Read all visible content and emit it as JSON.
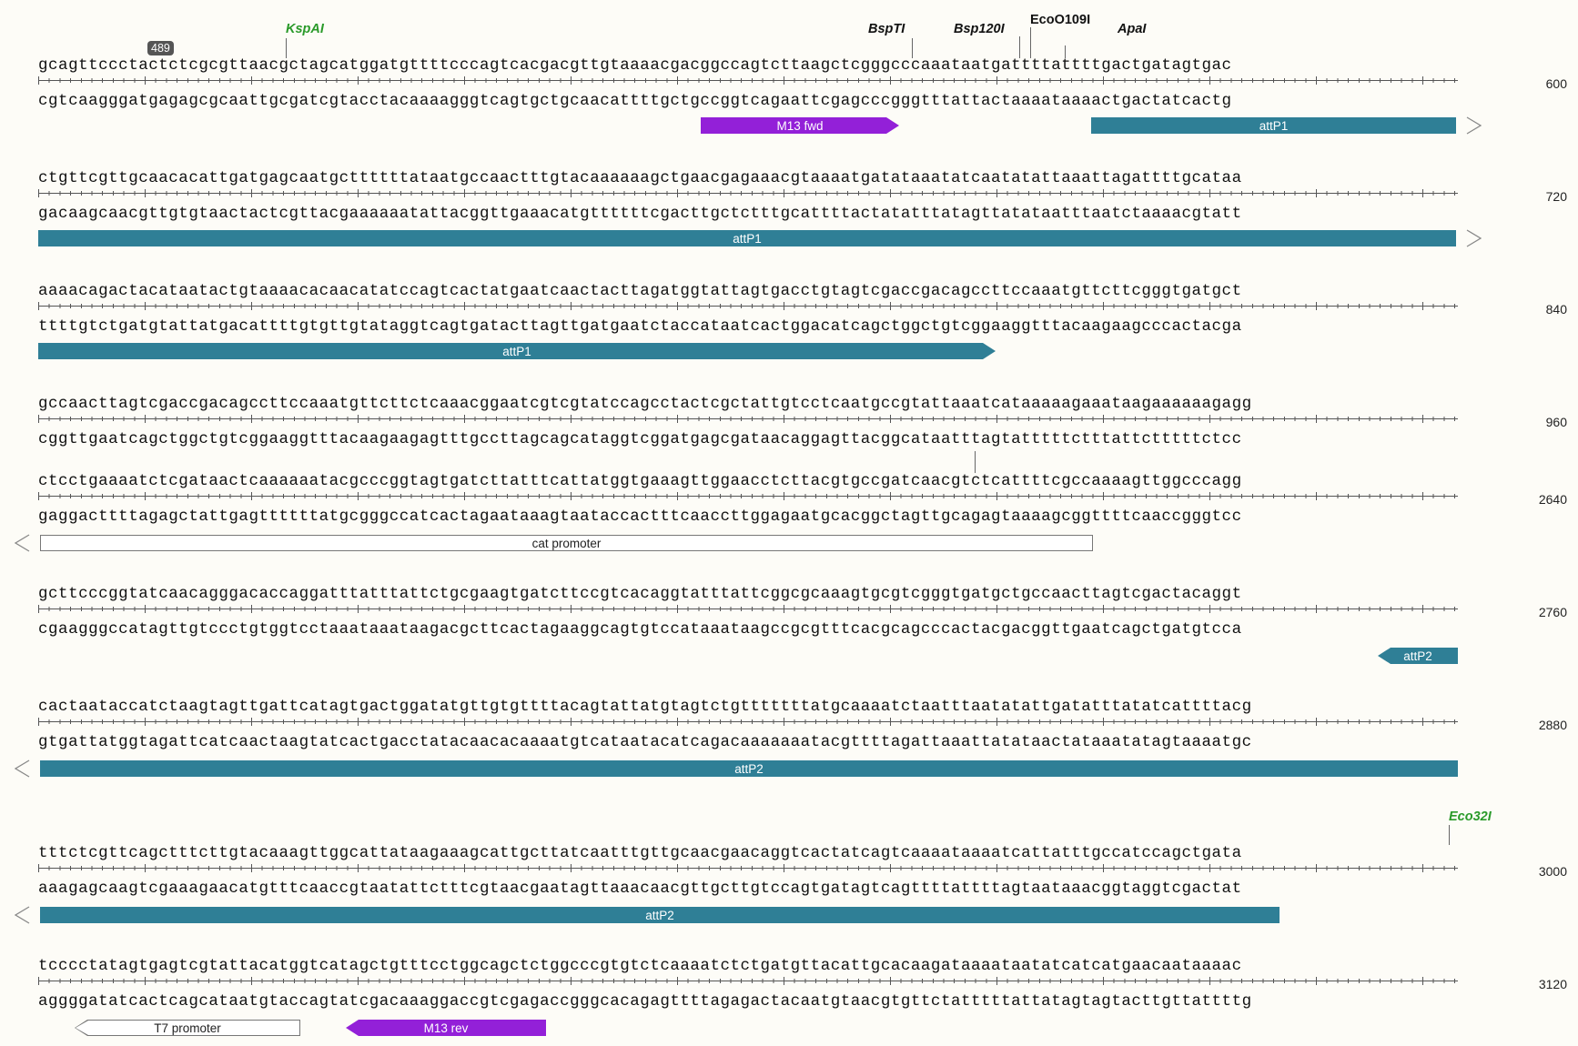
{
  "colors": {
    "background": "#fdfcf7",
    "feature_teal": "#2f7f96",
    "feature_purple": "#9320d8",
    "feature_white": "#ffffff",
    "enzyme_green": "#2a9a2a"
  },
  "badge": "489",
  "sites": {
    "kspai": "KspAI",
    "bspti": "BspTI",
    "bsp120i": "Bsp120I",
    "eco0109i": "EcoO109I",
    "apai": "ApaI",
    "eco32i": "Eco32I"
  },
  "rows": [
    {
      "top": "gcagttccctactctcgcgttaacgctagcatggatgttttcccagtcacgacgttgtaaaacgacggccagtcttaagctcgggcccaaataatgattttattttgactgatagtgac",
      "bottom": "cgtcaagggatgagagcgcaattgcgatcgtacctacaaaagggtcagtgctgcaacattttgctgccggtcagaattcgagcccgggtttattactaaaataaaactgactatcactg",
      "pos": "600",
      "features": [
        {
          "label": "M13 fwd"
        },
        {
          "label": "attP1"
        }
      ]
    },
    {
      "top": "ctgttcgttgcaacacattgatgagcaatgcttttttataatgccaactttgtacaaaaaagctgaacgagaaacgtaaaatgatataaatatcaatatattaaattagattttgcataa",
      "bottom": "gacaagcaacgttgtgtaactactcgttacgaaaaaatattacggttgaaacatgttttttcgacttgctctttgcattttactatatttatagttatataatttaatctaaaacgtatt",
      "pos": "720",
      "features": [
        {
          "label": "attP1"
        }
      ]
    },
    {
      "top": "aaaacagactacataatactgtaaaacacaacatatccagtcactatgaatcaactacttagatggtattagtgacctgtagtcgaccgacagccttccaaatgttcttcgggtgatgct",
      "bottom": "ttttgtctgatgtattatgacattttgtgttgtataggtcagtgatacttagttgatgaatctaccataatcactggacatcagctggctgtcggaaggtttacaagaagcccactacga",
      "pos": "840",
      "features": [
        {
          "label": "attP1"
        }
      ]
    },
    {
      "top": "gccaacttagtcgaccgacagccttccaaatgttcttctcaaacggaatcgtcgtatccagcctactcgctattgtcctcaatgccgtattaaatcataaaaagaaataagaaaaaagagg",
      "bottom": "cggttgaatcagctggctgtcggaaggtttacaagaagagtttgccttagcagcataggtcggatgagcgataacaggagttacggcataatttagtatttttctttattctttttctcc",
      "pos": "960",
      "features": []
    },
    {
      "top": "ctcctgaaaatctcgataactcaaaaaatacgcccggtagtgatcttatttcattatggtgaaagttggaacctcttacgtgccgatcaacgtctcattttcgccaaaagttggcccagg",
      "bottom": "gaggacttttagagctattgagttttttatgcgggccatcactagaataaagtaataccactttcaaccttggagaatgcacggctagttgcagagtaaaagcggttttcaaccgggtcc",
      "pos": "2640",
      "features": [
        {
          "label": "cat promoter"
        }
      ]
    },
    {
      "top": "gcttcccggtatcaacagggacaccaggatttatttattctgcgaagtgatcttccgtcacaggtatttattcggcgcaaagtgcgtcgggtgatgctgccaacttagtcgactacaggt",
      "bottom": "cgaagggccatagttgtccctgtggtcctaaataaataagacgcttcactagaaggcagtgtccataaataagccgcgtttcacgcagcccactacgacggttgaatcagctgatgtcca",
      "pos": "2760",
      "features": [
        {
          "label": "attP2"
        }
      ]
    },
    {
      "top": "cactaataccatctaagtagttgattcatagtgactggatatgttgtgttttacagtattatgtagtctgtttttttatgcaaaatctaatttaatatattgatatttatatcattttacg",
      "bottom": "gtgattatggtagattcatcaactaagtatcactgacctatacaacacaaaatgtcataatacatcagacaaaaaaatacgttttagattaaattatataactataaatatagtaaaatgc",
      "pos": "2880",
      "features": [
        {
          "label": "attP2"
        }
      ]
    },
    {
      "top": "tttctcgttcagctttcttgtacaaagttggcattataagaaagcattgcttatcaatttgttgcaacgaacaggtcactatcagtcaaaataaaatcattatttgccatccagctgata",
      "bottom": "aaagagcaagtcgaaagaacatgtttcaaccgtaatattctttcgtaacgaatagttaaacaacgttgcttgtccagtgatagtcagttttattttagtaataaacggtaggtcgactat",
      "pos": "3000",
      "features": [
        {
          "label": "attP2"
        }
      ]
    },
    {
      "top": "tcccctatagtgagtcgtattacatggtcatagctgtttcctggcagctctggcccgtgtctcaaaatctctgatgttacattgcacaagataaaataatatcatcatgaacaataaaac",
      "bottom": "aggggatatcactcagcataatgtaccagtatcgacaaaggaccgtcgagaccgggcacagagttttagagactacaatgtaacgtgttctatttttattatagtagtacttgttattttg",
      "pos": "3120",
      "features": [
        {
          "label": "T7 promoter"
        },
        {
          "label": "M13 rev"
        }
      ]
    }
  ]
}
